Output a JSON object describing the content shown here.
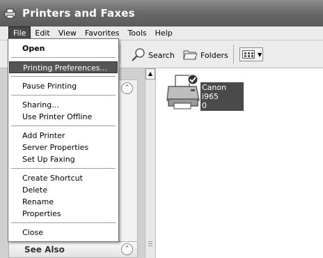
{
  "window": {
    "title": "Printers and Faxes"
  },
  "menubar": {
    "items": [
      "File",
      "Edit",
      "View",
      "Favorites",
      "Tools",
      "Help"
    ]
  },
  "toolbar": {
    "search_label": "Search",
    "folders_label": "Folders"
  },
  "file_menu": {
    "open": "Open",
    "printing_preferences": "Printing Preferences...",
    "pause_printing": "Pause Printing",
    "sharing": "Sharing...",
    "use_offline": "Use Printer Offline",
    "add_printer": "Add Printer",
    "server_properties": "Server Properties",
    "setup_faxing": "Set Up Faxing",
    "create_shortcut": "Create Shortcut",
    "delete": "Delete",
    "rename": "Rename",
    "properties": "Properties",
    "close": "Close"
  },
  "taskpane": {
    "see_also": "See Also"
  },
  "printer": {
    "name_line1": "Canon i965",
    "name_line2": "0"
  },
  "colors": {
    "highlight": "#555555",
    "titlebar": "#6a6a6a"
  }
}
